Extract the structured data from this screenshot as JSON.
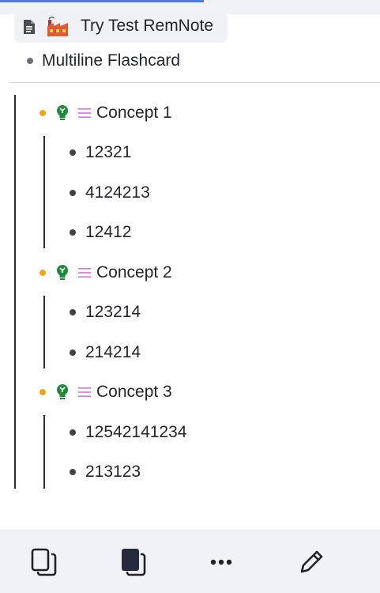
{
  "header": {
    "breadcrumb_label": "Try Test RemNote",
    "parent_label": "Multiline Flashcard"
  },
  "concepts": [
    {
      "label": "Concept 1",
      "children": [
        "12321",
        "4124213",
        "12412"
      ]
    },
    {
      "label": "Concept 2",
      "children": [
        "123214",
        "214214"
      ]
    },
    {
      "label": "Concept 3",
      "children": [
        "12542141234",
        "213123"
      ]
    }
  ],
  "icons": {
    "breadcrumb": [
      "document-icon",
      "factory-emoji-icon"
    ],
    "concept": [
      "concept-bulb-icon",
      "list-icon"
    ],
    "toolbar": [
      "cards-outline-icon",
      "cards-filled-icon",
      "more-icon",
      "edit-pencil-icon"
    ]
  },
  "colors": {
    "accent_progress": "#4a7fd4",
    "concept_bullet": "#f2a31b",
    "bulb_green": "#1e8a3c",
    "list_icon": "#c77dcc"
  }
}
